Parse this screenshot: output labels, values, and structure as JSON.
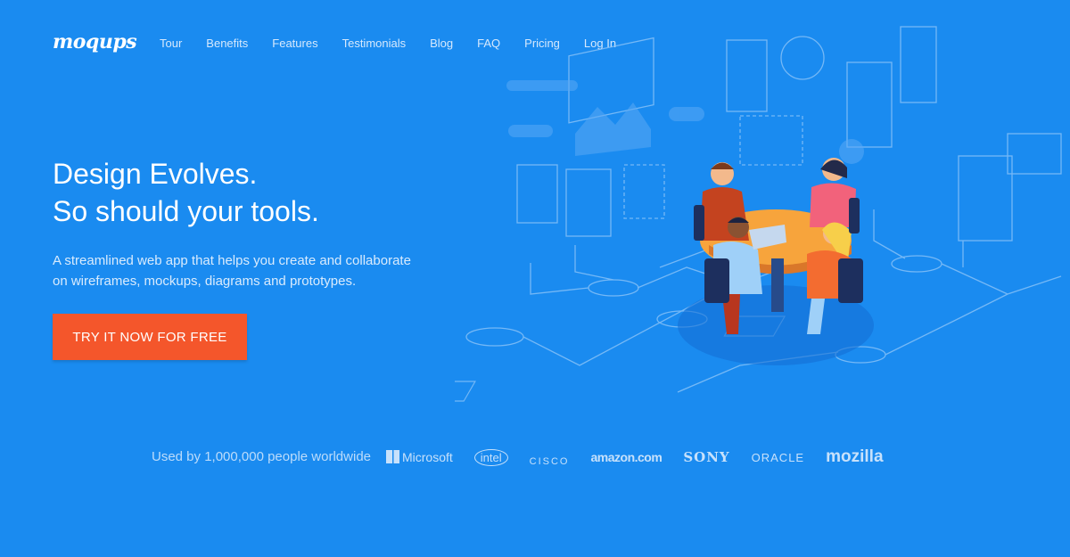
{
  "brand": "moqups",
  "nav": [
    "Tour",
    "Benefits",
    "Features",
    "Testimonials",
    "Blog",
    "FAQ",
    "Pricing",
    "Log In"
  ],
  "hero": {
    "title_line1": "Design Evolves.",
    "title_line2": "So should your tools.",
    "subtitle": "A streamlined web app that helps you create and collaborate on wireframes, mockups, diagrams and prototypes.",
    "cta": "TRY IT NOW FOR FREE"
  },
  "social_proof": {
    "text": "Used by 1,000,000 people worldwide",
    "logos": [
      "Microsoft",
      "intel",
      "CISCO",
      "amazon.com",
      "SONY",
      "ORACLE",
      "mozilla"
    ]
  },
  "colors": {
    "background": "#1a8bf0",
    "cta": "#f4562b"
  }
}
